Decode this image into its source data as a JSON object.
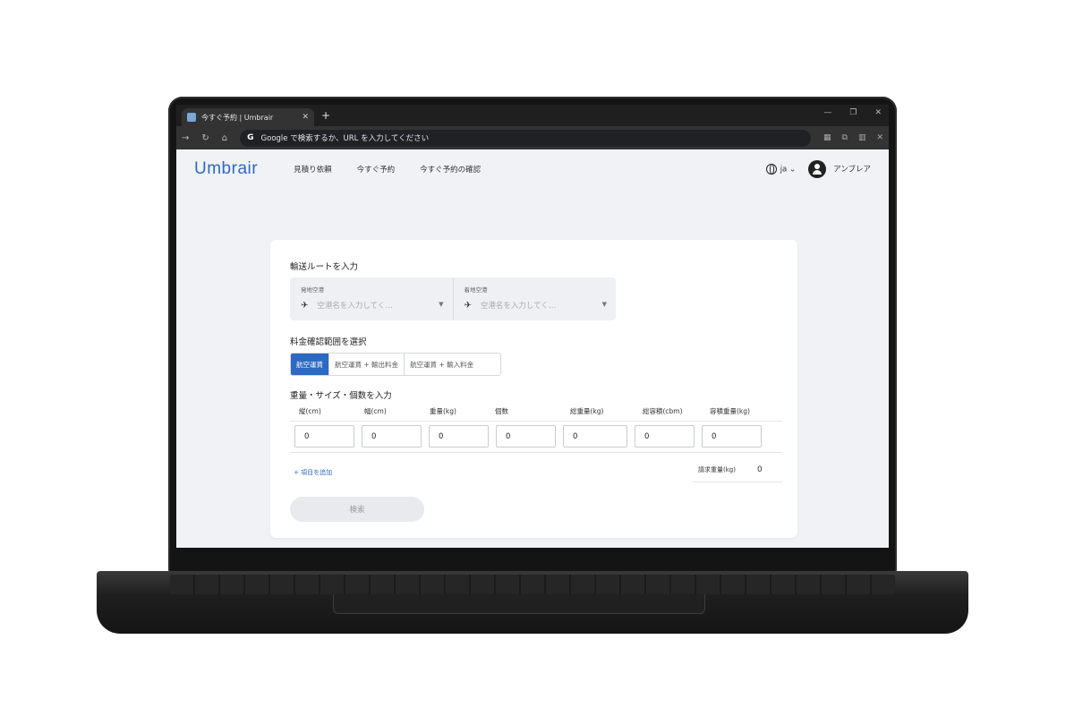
{
  "browser": {
    "tab_title": "今すぐ予約 | Umbrair",
    "tab_close": "✕",
    "new_tab": "+",
    "omnibox_text": "Google で検索するか、URL を入力してください",
    "window_controls": [
      "—",
      "❐",
      "✕"
    ]
  },
  "app": {
    "logo": "Umbrair",
    "nav": [
      "見積り依頼",
      "今すぐ予約",
      "今すぐ予約の確認"
    ],
    "language": "ja",
    "user_name": "アンブレア"
  },
  "route": {
    "title": "輸送ルートを入力",
    "origin_label": "発地空港",
    "origin_placeholder": "空港名を入力してく…",
    "dest_label": "着地空港",
    "dest_placeholder": "空港名を入力してく…"
  },
  "range": {
    "title": "料金確認範囲を選択",
    "options": [
      "航空運賃",
      "航空運賃 + 輸出料金",
      "航空運賃 + 輸入料金"
    ],
    "selected": "航空運賃"
  },
  "cargo": {
    "title": "重量・サイズ・個数を入力",
    "columns": [
      "縦(cm)",
      "幅(cm)",
      "重量(kg)",
      "個数",
      "総重量(kg)",
      "総容積(cbm)",
      "容積重量(kg)"
    ],
    "values": [
      "0",
      "0",
      "0",
      "0",
      "0",
      "0",
      "0"
    ],
    "add_item": "+ 項目を追加",
    "billed_label": "請求重量(kg)",
    "billed_value": "0"
  },
  "search_button": "検索",
  "colors": {
    "accent": "#2b69c2",
    "page_bg": "#f1f2f5"
  }
}
